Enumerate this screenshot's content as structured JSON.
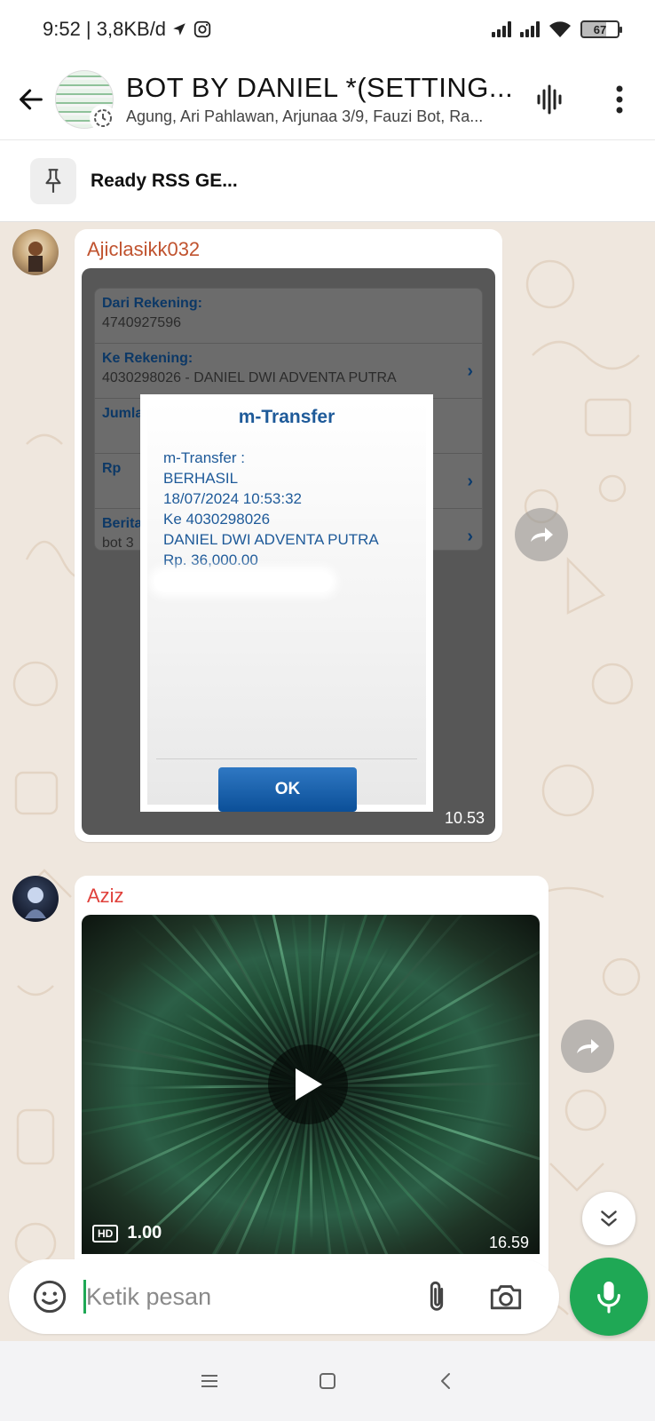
{
  "status_bar": {
    "time_speed": "9:52 | 3,8KB/d",
    "battery": "67"
  },
  "header": {
    "title": "BOT BY DANIEL *(SETTING...",
    "subtitle": "Agung, Ari Pahlawan, Arjunaa 3/9, Fauzi Bot, Ra..."
  },
  "pinned": {
    "text": "Ready RSS GE..."
  },
  "messages": [
    {
      "sender": "Ajiclasikk032",
      "sender_color": "#c0532f",
      "time": "10.53",
      "image": {
        "bank_rows": [
          {
            "label": "Dari Rekening:",
            "value": "4740927596"
          },
          {
            "label": "Ke Rekening:",
            "value": "4030298026 - DANIEL DWI ADVENTA PUTRA"
          },
          {
            "label": "Jumla",
            "value": ""
          },
          {
            "label": "Rp",
            "value": ""
          },
          {
            "label": "Berita",
            "value": "bot 3"
          }
        ],
        "dialog_title": "m-Transfer",
        "dialog_lines": [
          "m-Transfer :",
          "BERHASIL",
          "18/07/2024 10:53:32",
          "Ke 4030298026",
          "DANIEL DWI ADVENTA PUTRA",
          "Rp. 36,000.00"
        ],
        "ok_label": "OK"
      }
    },
    {
      "sender": "Aziz",
      "sender_color": "#e0413b",
      "time": "16.59",
      "video": {
        "quality": "HD",
        "duration": "1.00"
      }
    }
  ],
  "input": {
    "placeholder": "Ketik pesan"
  },
  "colors": {
    "accent": "#1fa855",
    "chat_bg": "#efe7de"
  }
}
